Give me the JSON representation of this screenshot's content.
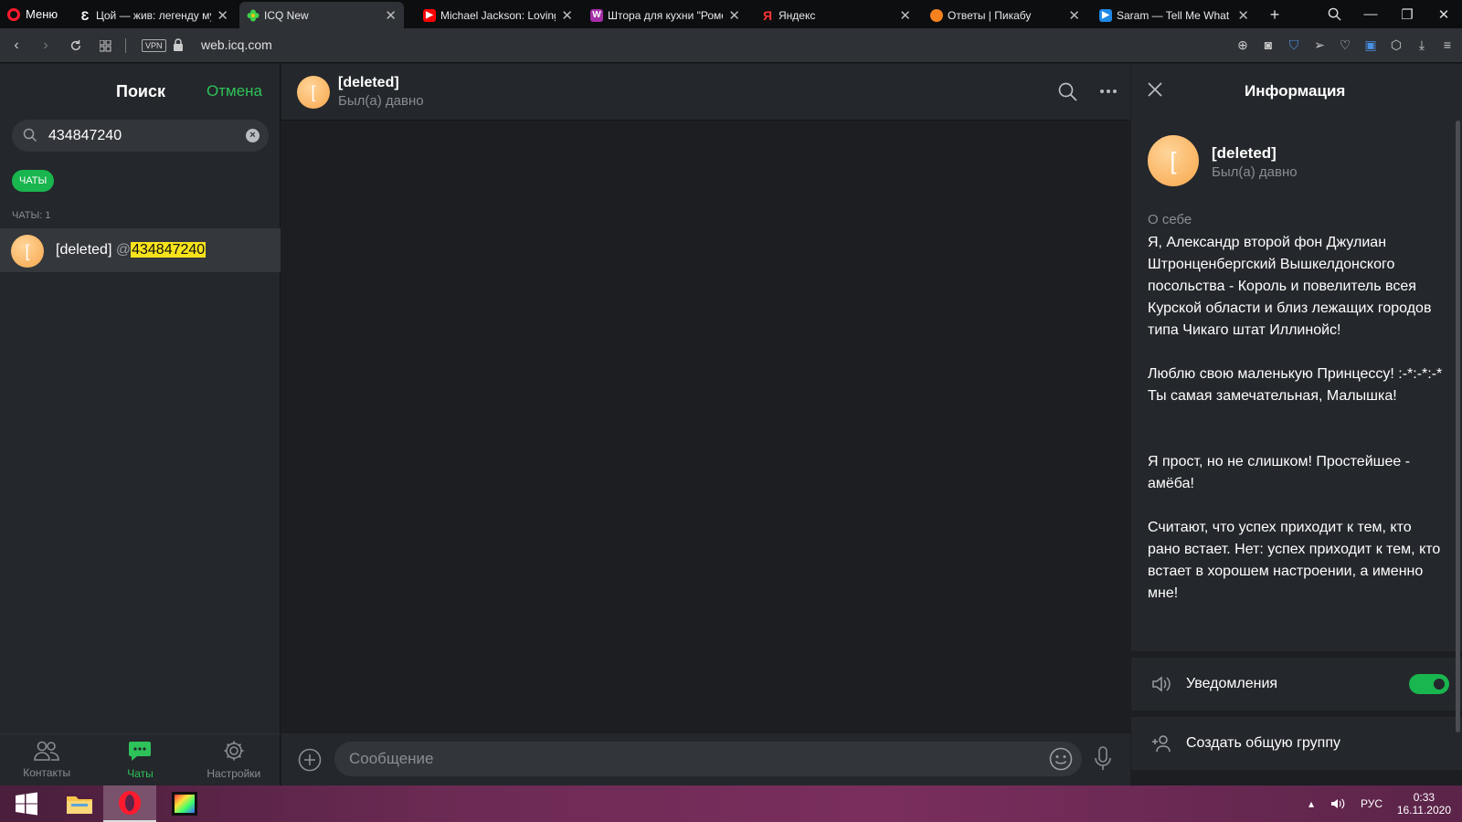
{
  "browser": {
    "menu_label": "Меню",
    "tabs": [
      {
        "title": "Цой — жив: легенду му",
        "icon": "e-icon"
      },
      {
        "title": "ICQ New",
        "icon": "icq-flower-icon"
      },
      {
        "title": "Michael Jackson: Loving",
        "icon": "youtube-icon"
      },
      {
        "title": "Штора для кухни \"Роме",
        "icon": "w-icon"
      },
      {
        "title": "Яндекс",
        "icon": "yandex-icon"
      },
      {
        "title": "Ответы | Пикабу",
        "icon": "pikabu-icon"
      },
      {
        "title": "Saram — Tell Me What H",
        "icon": "play-icon"
      }
    ],
    "vpn_label": "VPN",
    "url": "web.icq.com",
    "new_tab_label": "+"
  },
  "left": {
    "title": "Поиск",
    "cancel_label": "Отмена",
    "search_value": "434847240",
    "filter_chip": "ЧАТЫ",
    "count_label": "ЧАТЫ: 1",
    "results": [
      {
        "avatar_letter": "[",
        "name": "[deleted]",
        "at": "@",
        "handle": "434847240"
      }
    ],
    "nav": [
      {
        "label": "Контакты",
        "icon": "contacts-icon"
      },
      {
        "label": "Чаты",
        "icon": "chats-icon"
      },
      {
        "label": "Настройки",
        "icon": "settings-gear-icon"
      }
    ]
  },
  "chat": {
    "avatar_letter": "[",
    "name": "[deleted]",
    "status": "Был(а) давно",
    "composer_placeholder": "Сообщение"
  },
  "info": {
    "title": "Информация",
    "avatar_letter": "[",
    "name": "[deleted]",
    "status": "Был(а) давно",
    "about_label": "О себе",
    "about_text": "Я, Александр второй фон Джулиан Штронценбергский Вышкелдонского посольства - Король и повелитель всея Курской области и близ лежащих городов типа Чикаго штат Иллинойс!\n\nЛюблю свою маленькую Принцессу! :-*:-*:-* Ты самая замечательная, Малышка!\n\n\nЯ прост, но не слишком! Простейшее - амёба!\n\nСчитают, что успех приходит к тем, кто рано встает. Нет: успех приходит к тем, кто встает в хорошем настроении, а именно мне!",
    "notifications_label": "Уведомления",
    "notifications_on": true,
    "create_group_label": "Создать общую группу"
  },
  "taskbar": {
    "lang": "РУС",
    "time": "0:33",
    "date": "16.11.2020"
  },
  "colors": {
    "accent_green": "#19b54f",
    "highlight_yellow": "#f7e31b",
    "avatar_orange": "#f7a64a",
    "panel_bg": "#24272b",
    "chat_bg": "#1c1e22"
  }
}
